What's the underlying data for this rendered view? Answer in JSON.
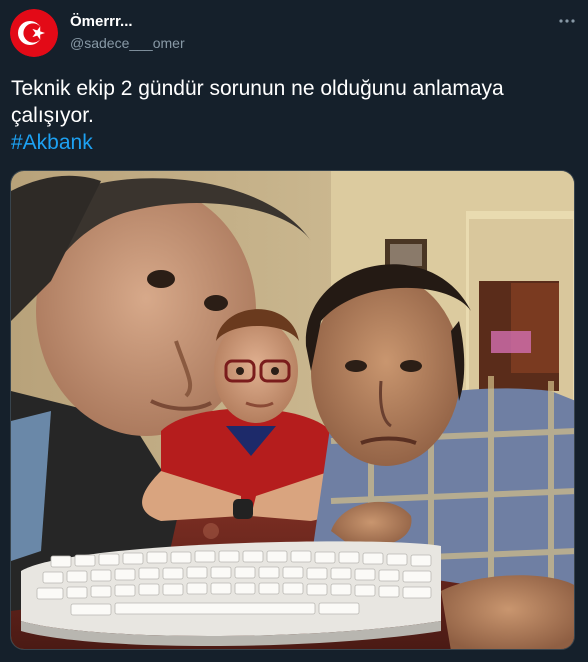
{
  "tweet": {
    "author": {
      "display_name": "Ömerrr...",
      "handle": "@sadece___omer",
      "avatar_icon": "turkish-flag-icon",
      "avatar_colors": {
        "background": "#e30a17",
        "symbol": "#ffffff"
      }
    },
    "more_icon": "more-options-icon",
    "text_line_1": "Teknik ekip 2 gündür sorunun ne olduğunu anlamaya",
    "text_line_2": "çalışıyor.",
    "hashtag": "#Akbank",
    "media": {
      "type": "photo",
      "icon": "photo-image"
    }
  },
  "colors": {
    "background": "#15202b",
    "text_primary": "#ffffff",
    "text_secondary": "#8899a6",
    "link": "#1da1f2",
    "border": "#38444d"
  }
}
